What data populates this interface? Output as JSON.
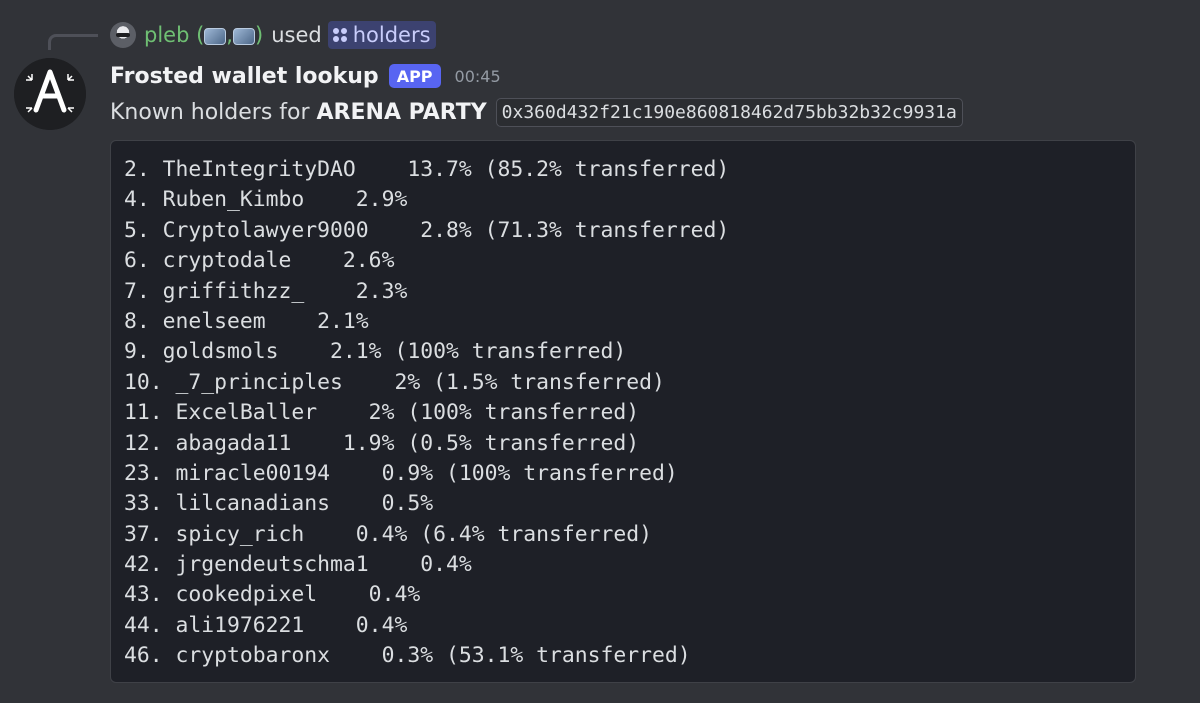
{
  "reply": {
    "username": "pleb (",
    "username_close": ")",
    "separator": ",",
    "used_text": "used",
    "command": "holders",
    "icons": [
      "user-avatar-icon",
      "blue-cube-emoji-icon",
      "blue-cube-emoji-icon",
      "slash-command-icon"
    ]
  },
  "message": {
    "author": "Frosted wallet lookup",
    "badge": "APP",
    "timestamp": "00:45",
    "avatar_icon": "frosted-logo-icon",
    "content_prefix": "Known holders for",
    "token_name": "ARENA PARTY",
    "contract": "0x360d432f21c190e860818462d75bb32b32c9931a"
  },
  "holders": [
    {
      "line": "2. TheIntegrityDAO    13.7% (85.2% transferred)"
    },
    {
      "line": "4. Ruben_Kimbo    2.9%"
    },
    {
      "line": "5. Cryptolawyer9000    2.8% (71.3% transferred)"
    },
    {
      "line": "6. cryptodale    2.6%"
    },
    {
      "line": "7. griffithzz_    2.3%"
    },
    {
      "line": "8. enelseem    2.1%"
    },
    {
      "line": "9. goldsmols    2.1% (100% transferred)"
    },
    {
      "line": "10. _7_principles    2% (1.5% transferred)"
    },
    {
      "line": "11. ExcelBaller    2% (100% transferred)"
    },
    {
      "line": "12. abagada11    1.9% (0.5% transferred)"
    },
    {
      "line": "23. miracle00194    0.9% (100% transferred)"
    },
    {
      "line": "33. lilcanadians    0.5%"
    },
    {
      "line": "37. spicy_rich    0.4% (6.4% transferred)"
    },
    {
      "line": "42. jrgendeutschma1    0.4%"
    },
    {
      "line": "43. cookedpixel    0.4%"
    },
    {
      "line": "44. ali1976221    0.4%"
    },
    {
      "line": "46. cryptobaronx    0.3% (53.1% transferred)"
    }
  ],
  "colors": {
    "background": "#313338",
    "code_background": "#1e2027",
    "app_badge": "#5865f2",
    "username": "#6fbf73",
    "command_pill": "#3c4270"
  }
}
